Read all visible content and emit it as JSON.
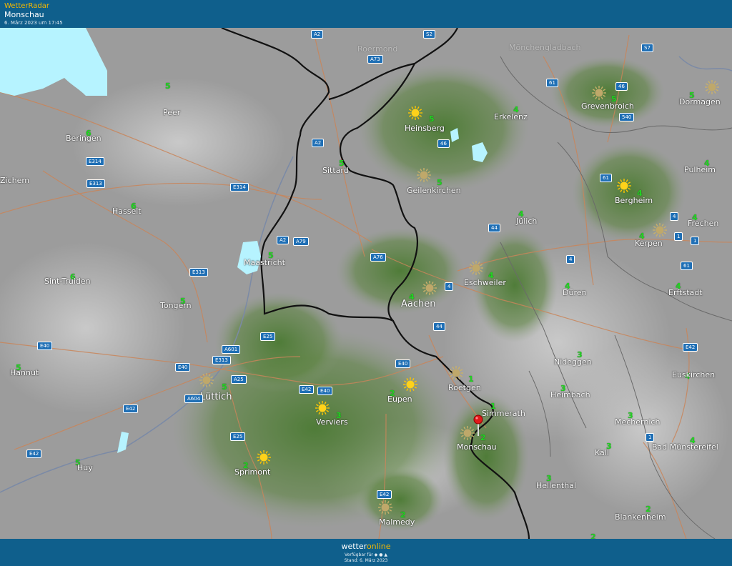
{
  "header": {
    "brand": "WetterRadar",
    "location": "Monschau",
    "timestamp": "6. März 2023 um 17:45"
  },
  "footer": {
    "logo_a": "wetter",
    "logo_b": "online",
    "line1": "Verfügbar für  ◆ ● ▲",
    "line2": "Stand: 6. März 2023"
  },
  "colors": {
    "bar": "#0f5f8c",
    "accent": "#f5b800",
    "forest": "#4f7d35",
    "number": "#22d322",
    "water": "#b6f3ff"
  },
  "cities": [
    {
      "name": "Peer",
      "num": "5",
      "icon": ""
    },
    {
      "name": "Beringen",
      "num": "6",
      "icon": ""
    },
    {
      "name": "-Zichem",
      "num": "",
      "icon": ""
    },
    {
      "name": "Hasselt",
      "num": "6",
      "icon": ""
    },
    {
      "name": "Sint-Truiden",
      "num": "6",
      "icon": ""
    },
    {
      "name": "Tongern",
      "num": "5",
      "icon": ""
    },
    {
      "name": "Hannut",
      "num": "5",
      "icon": ""
    },
    {
      "name": "Lüttich",
      "num": "5",
      "icon": "sun-faded"
    },
    {
      "name": "Huy",
      "num": "5",
      "icon": ""
    },
    {
      "name": "Sprimont",
      "num": "2",
      "icon": "sun"
    },
    {
      "name": "Verviers",
      "num": "3",
      "icon": "sun"
    },
    {
      "name": "Eupen",
      "num": "2",
      "icon": "sun"
    },
    {
      "name": "Malmedy",
      "num": "2",
      "icon": "sun-faded"
    },
    {
      "name": "Maastricht",
      "num": "5",
      "icon": ""
    },
    {
      "name": "Sittard",
      "num": "5",
      "icon": ""
    },
    {
      "name": "Heinsberg",
      "num": "5",
      "icon": "sun"
    },
    {
      "name": "Geilenkirchen",
      "num": "5",
      "icon": "sun-faded"
    },
    {
      "name": "Aachen",
      "num": "4",
      "icon": "sun-faded"
    },
    {
      "name": "Eschweiler",
      "num": "4",
      "icon": "sun-faded"
    },
    {
      "name": "Erkelenz",
      "num": "4",
      "icon": ""
    },
    {
      "name": "Jülich",
      "num": "4",
      "icon": ""
    },
    {
      "name": "Grevenbroich",
      "num": "5",
      "icon": "sun-faded"
    },
    {
      "name": "Dormagen",
      "num": "5",
      "icon": "sun-faded"
    },
    {
      "name": "Pulheim",
      "num": "4",
      "icon": ""
    },
    {
      "name": "Bergheim",
      "num": "4",
      "icon": "sun"
    },
    {
      "name": "Frechen",
      "num": "4",
      "icon": ""
    },
    {
      "name": "Kerpen",
      "num": "4",
      "icon": "sun-faded"
    },
    {
      "name": "Düren",
      "num": "4",
      "icon": ""
    },
    {
      "name": "Erftstadt",
      "num": "4",
      "icon": ""
    },
    {
      "name": "Roetgen",
      "num": "1",
      "icon": "sun-faded"
    },
    {
      "name": "Simmerath",
      "num": "1",
      "icon": ""
    },
    {
      "name": "Monschau",
      "num": "2",
      "icon": "sun-faded"
    },
    {
      "name": "Nideggen",
      "num": "3",
      "icon": ""
    },
    {
      "name": "Heimbach",
      "num": "3",
      "icon": ""
    },
    {
      "name": "Euskirchen",
      "num": "4",
      "icon": ""
    },
    {
      "name": "Mechernich",
      "num": "3",
      "icon": ""
    },
    {
      "name": "Kall",
      "num": "3",
      "icon": ""
    },
    {
      "name": "Bad Münstereifel",
      "num": "4",
      "icon": ""
    },
    {
      "name": "Hellenthal",
      "num": "3",
      "icon": ""
    },
    {
      "name": "Blankenheim",
      "num": "2",
      "icon": ""
    }
  ],
  "extra_numbers": [
    "2"
  ],
  "roads": [
    "A2",
    "S2",
    "A73",
    "A2",
    "61",
    "46",
    "540",
    "S7",
    "E314",
    "E313",
    "E314",
    "46",
    "A2",
    "A79",
    "A76",
    "44",
    "61",
    "4",
    "4",
    "4",
    "1",
    "61",
    "E313",
    "E25",
    "A601",
    "E313",
    "E40",
    "E40",
    "A25",
    "A604",
    "E42",
    "E40",
    "E42",
    "E40",
    "E42",
    "44",
    "E25",
    "E42",
    "E42",
    "1",
    "1"
  ],
  "map_labels": [
    "Roermond",
    "Mönchengladbach"
  ]
}
